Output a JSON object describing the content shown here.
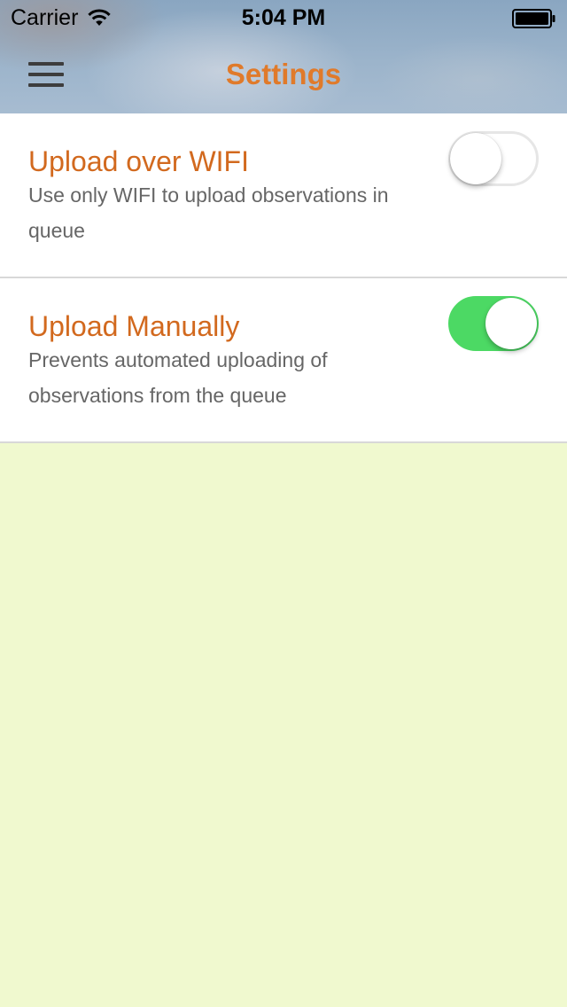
{
  "status_bar": {
    "carrier": "Carrier",
    "time": "5:04 PM",
    "wifi_icon": "wifi-icon",
    "battery_icon": "battery-icon"
  },
  "nav": {
    "title": "Settings",
    "menu_icon": "hamburger-menu-icon"
  },
  "settings": [
    {
      "title": "Upload over WIFI",
      "description": "Use only WIFI to upload observations in queue",
      "enabled": false
    },
    {
      "title": "Upload Manually",
      "description": "Prevents automated uploading of observations from the queue",
      "enabled": true
    }
  ],
  "colors": {
    "accent": "#d2691e",
    "title_accent": "#e07a2a",
    "toggle_on": "#4cd964",
    "background": "#f0f9cf",
    "description_text": "#666666"
  }
}
